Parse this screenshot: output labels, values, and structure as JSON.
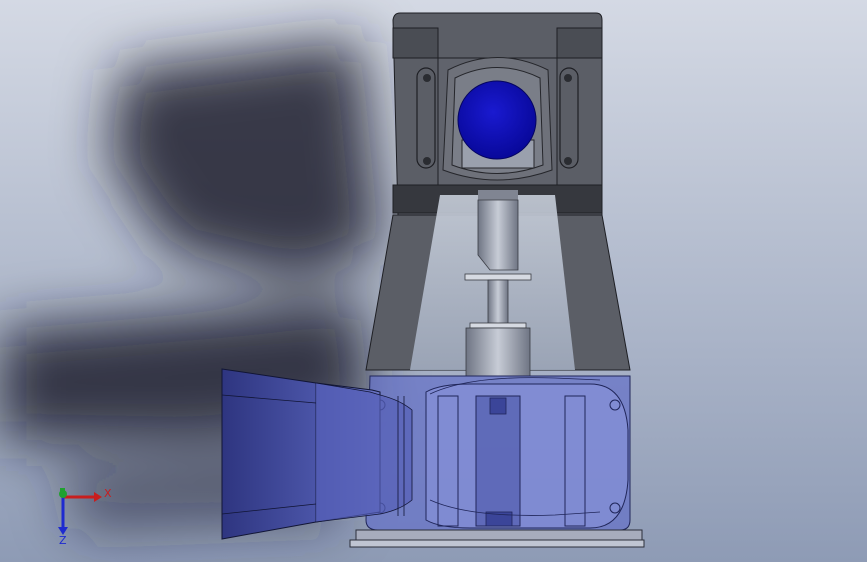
{
  "viewport": {
    "background_top": "#d4d9e4",
    "background_bottom": "#8e9bb5",
    "shadow_color": "#1c2030"
  },
  "model": {
    "housing_color": "#5b5e66",
    "housing_dark": "#36383e",
    "cutaway_color": "#bfc8d6",
    "transparent_part_color": "#6470c8",
    "disc_color": "#0a0ab0",
    "base_plate_color": "#a7acbd"
  },
  "triad": {
    "x_label": "X",
    "z_label": "Z",
    "x_color": "#c81e1e",
    "y_color": "#1fa12f",
    "z_color": "#1e2ad0"
  }
}
